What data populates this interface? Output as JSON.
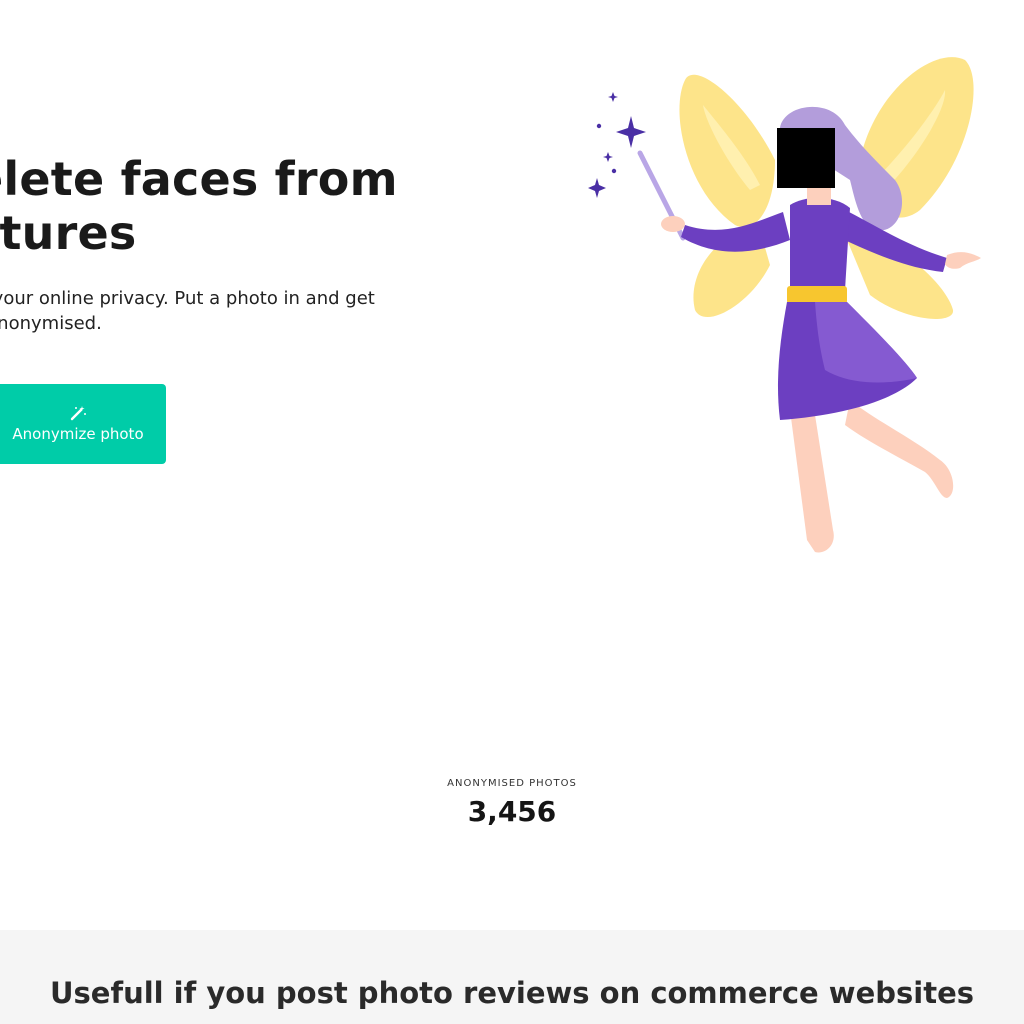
{
  "hero": {
    "title_line1": "elete faces from",
    "title_line2": "ctures",
    "subtitle_line1": "ct your online privacy. Put a photo in and get",
    "subtitle_line2": "k anonymised."
  },
  "cta": {
    "label": "Anonymize photo",
    "icon": "magic-wand-icon"
  },
  "illustration": {
    "name": "fairy-illustration",
    "colors": {
      "wings": "#fde48a",
      "dress": "#6c3fc1",
      "hair": "#b39ddb",
      "belt": "#f7c62f",
      "skin": "#fdd0bd",
      "sparkles": "#4a2fa5"
    }
  },
  "stats": {
    "label": "ANONYMISED PHOTOS",
    "value": "3,456"
  },
  "use_case": {
    "heading": "Usefull if you post photo reviews on commerce websites"
  },
  "colors": {
    "accent": "#00cca8",
    "section_bg": "#f5f5f5"
  }
}
